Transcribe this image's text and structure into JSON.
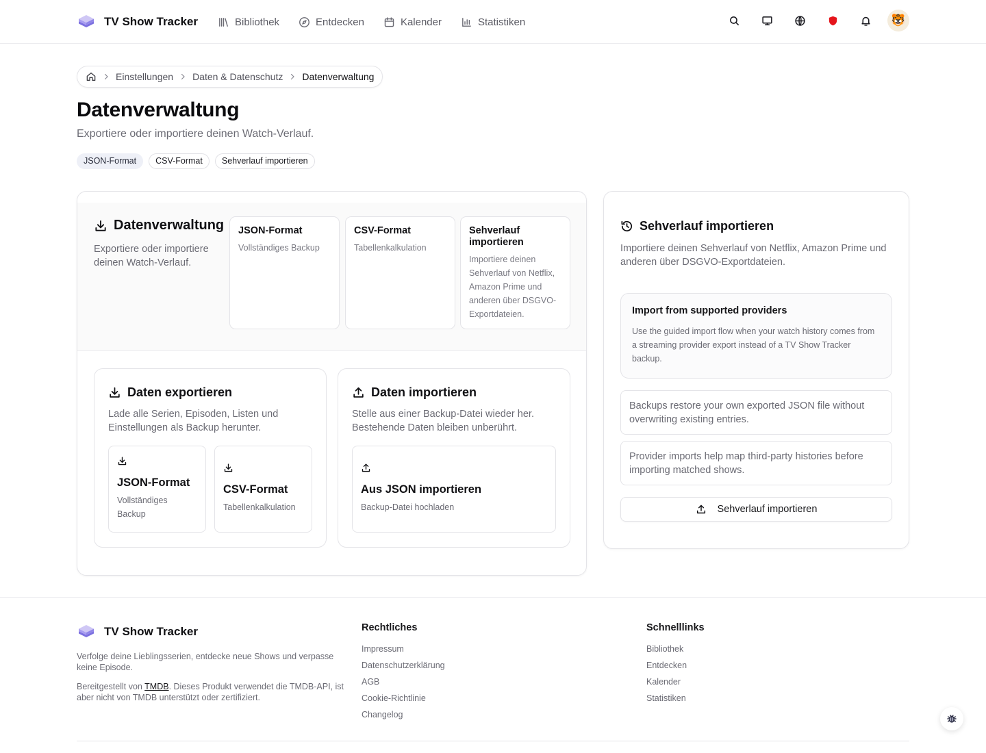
{
  "app": {
    "name": "TV Show Tracker"
  },
  "nav": {
    "items": [
      {
        "label": "Bibliothek",
        "icon": "library-icon"
      },
      {
        "label": "Entdecken",
        "icon": "compass-icon"
      },
      {
        "label": "Kalender",
        "icon": "calendar-icon"
      },
      {
        "label": "Statistiken",
        "icon": "bar-chart-icon"
      }
    ]
  },
  "header_tools": {
    "icons": [
      "search-icon",
      "monitor-icon",
      "globe-icon",
      "shield-icon",
      "bell-icon"
    ],
    "shield_color": "#e5141b",
    "avatar": "🐯"
  },
  "breadcrumb": {
    "items": [
      "Einstellungen",
      "Daten & Datenschutz"
    ],
    "current": "Datenverwaltung"
  },
  "page": {
    "title": "Datenverwaltung",
    "subtitle": "Exportiere oder importiere deinen Watch-Verlauf.",
    "chips": [
      "JSON-Format",
      "CSV-Format",
      "Sehverlauf importieren"
    ]
  },
  "overview": {
    "title": "Datenverwaltung",
    "description": "Exportiere oder importiere deinen Watch-Verlauf.",
    "cards": [
      {
        "title": "JSON-Format",
        "desc": "Vollständiges Backup"
      },
      {
        "title": "CSV-Format",
        "desc": "Tabellenkalkulation"
      },
      {
        "title": "Sehverlauf importieren",
        "desc": "Importiere deinen Sehverlauf von Netflix, Amazon Prime und anderen über DSGVO-Exportdateien."
      }
    ]
  },
  "export": {
    "title": "Daten exportieren",
    "description": "Lade alle Serien, Episoden, Listen und Einstellungen als Backup herunter.",
    "options": [
      {
        "title": "JSON-Format",
        "desc": "Vollständiges Backup"
      },
      {
        "title": "CSV-Format",
        "desc": "Tabellenkalkulation"
      }
    ]
  },
  "import": {
    "title": "Daten importieren",
    "description": "Stelle aus einer Backup-Datei wieder her. Bestehende Daten bleiben unberührt.",
    "option": {
      "title": "Aus JSON importieren",
      "desc": "Backup-Datei hochladen"
    }
  },
  "history_import": {
    "title": "Sehverlauf importieren",
    "description": "Importiere deinen Sehverlauf von Netflix, Amazon Prime und anderen über DSGVO-Exportdateien.",
    "providers_title": "Import from supported providers",
    "providers_text": "Use the guided import flow when your watch history comes from a streaming provider export instead of a TV Show Tracker backup.",
    "notes": [
      "Backups restore your own exported JSON file without overwriting existing entries.",
      "Provider imports help map third-party histories before importing matched shows."
    ],
    "button_label": "Sehverlauf importieren"
  },
  "footer": {
    "brand": "TV Show Tracker",
    "tagline": "Verfolge deine Lieblingsserien, entdecke neue Shows und verpasse keine Episode.",
    "attribution_prefix": "Bereitgestellt von ",
    "attribution_link": "TMDB",
    "attribution_suffix": ". Dieses Produkt verwendet die TMDB-API, ist aber nicht von TMDB unterstützt oder zertifiziert.",
    "legal_title": "Rechtliches",
    "legal_links": [
      "Impressum",
      "Datenschutzerklärung",
      "AGB",
      "Cookie-Richtlinie",
      "Changelog"
    ],
    "quick_title": "Schnelllinks",
    "quick_links": [
      "Bibliothek",
      "Entdecken",
      "Kalender",
      "Statistiken"
    ]
  },
  "colors": {
    "brand_stack_top": "#c9c1f2",
    "brand_stack_bottom": "#6b5fd8",
    "active_chip_bg": "#eef0f7"
  }
}
